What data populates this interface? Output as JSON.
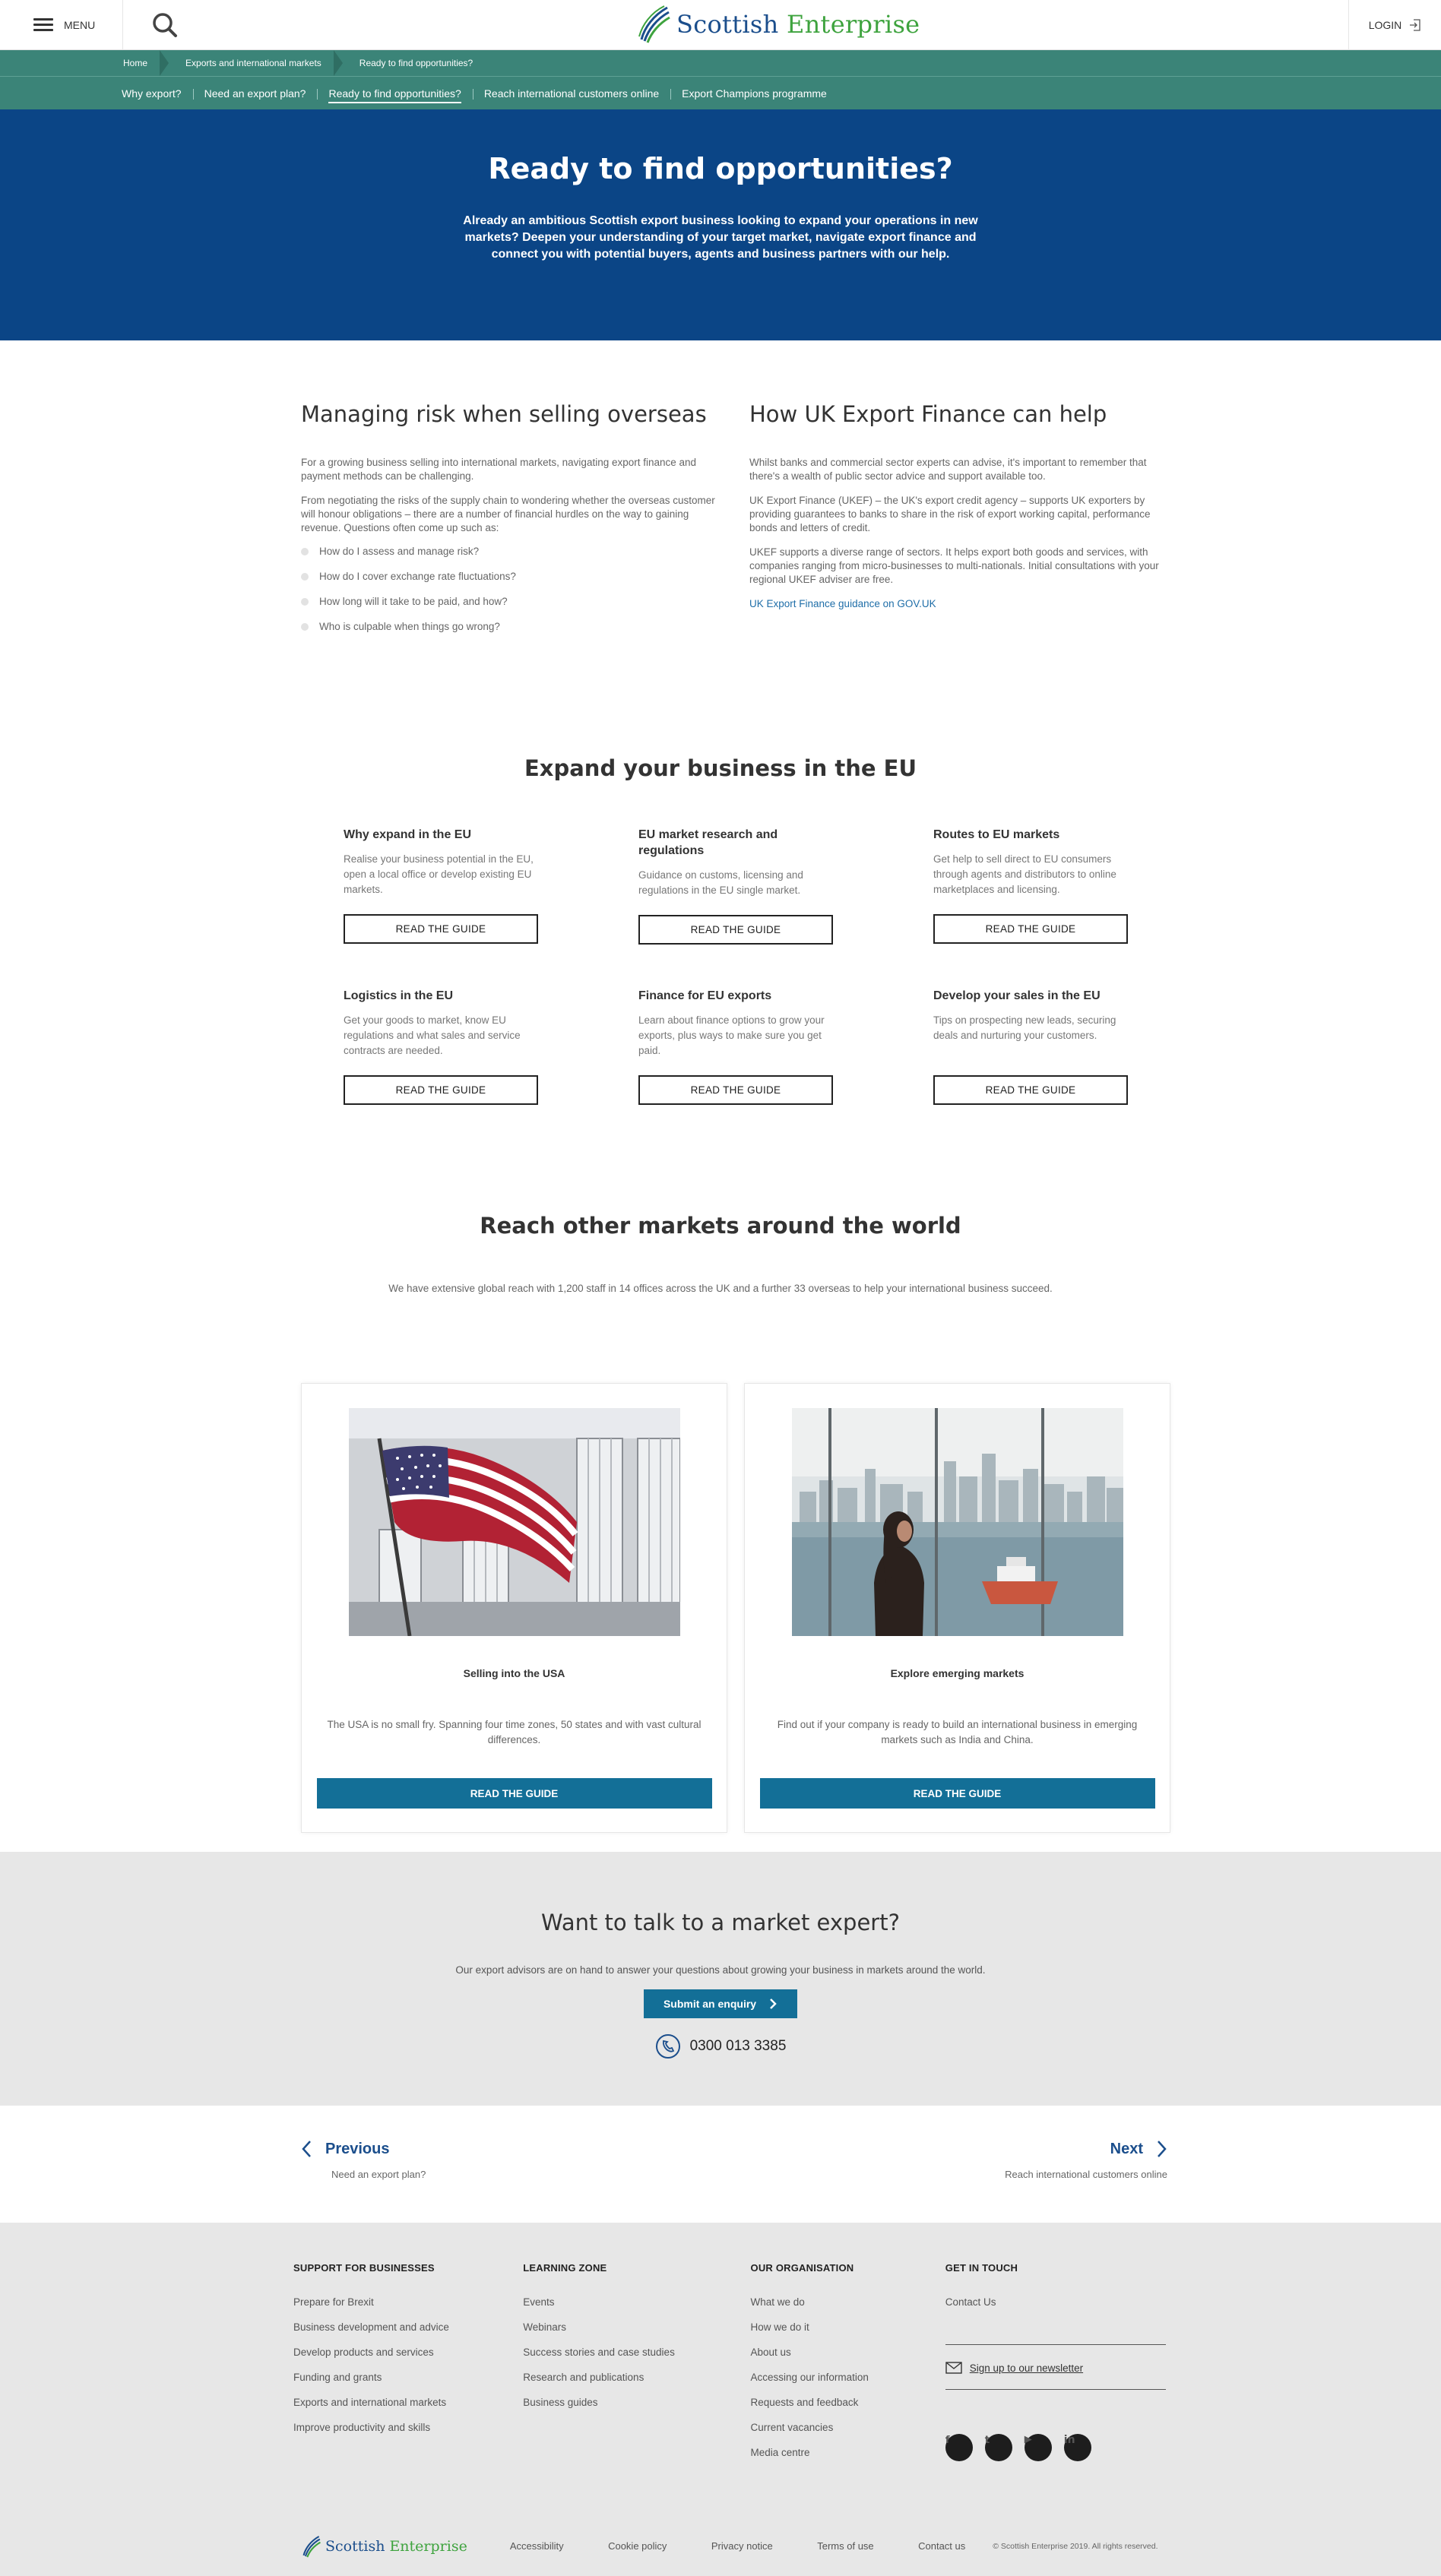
{
  "header": {
    "menu_label": "MENU",
    "logo_word1": "Scottish",
    "logo_word2": "Enterprise",
    "login_label": "LOGIN"
  },
  "breadcrumb": [
    "Home",
    "Exports and international markets",
    "Ready to find opportunities?"
  ],
  "subnav": [
    {
      "label": "Why export?",
      "active": false
    },
    {
      "label": "Need an export plan?",
      "active": false
    },
    {
      "label": "Ready to find opportunities?",
      "active": true
    },
    {
      "label": "Reach international customers online",
      "active": false
    },
    {
      "label": "Export Champions programme",
      "active": false
    }
  ],
  "hero": {
    "title": "Ready to find opportunities?",
    "text": "Already an ambitious Scottish export business looking to expand your operations in new markets? Deepen your understanding of your target market, navigate export finance and connect you with potential buyers, agents and business partners with our help."
  },
  "risk": {
    "title": "Managing risk when selling overseas",
    "p1": "For a growing business selling into international markets, navigating export finance and payment methods can be challenging.",
    "p2": "From negotiating the risks of the supply chain to wondering whether the overseas customer will honour obligations – there are a number of financial hurdles on the way to gaining revenue. Questions often come up such as:",
    "questions": [
      "How do I assess and manage risk?",
      "How do I cover exchange rate fluctuations?",
      "How long will it take to be paid, and how?",
      "Who is culpable when things go wrong?"
    ]
  },
  "ukef": {
    "title": "How UK Export Finance can help",
    "p1": "Whilst banks and commercial sector experts can advise, it's important to remember that there's a wealth of public sector advice and support available too.",
    "p2": "UK Export Finance (UKEF) – the UK's export credit agency – supports UK exporters by providing guarantees to banks to share in the risk of export working capital, performance bonds and letters of credit.",
    "p3": "UKEF supports a diverse range of sectors. It helps export both goods and services, with companies ranging from micro-businesses to multi-nationals. Initial consultations with your regional UKEF adviser are free.",
    "link": "UK Export Finance guidance on GOV.UK"
  },
  "eu": {
    "title": "Expand your business in the EU",
    "button_label": "READ THE GUIDE",
    "cards": [
      {
        "title": "Why expand in the EU",
        "text": "Realise your business potential in the EU, open a local office or develop existing EU markets."
      },
      {
        "title": "EU market research and regulations",
        "text": "Guidance on customs, licensing and regulations in the EU single market."
      },
      {
        "title": "Routes to EU markets",
        "text": "Get help to sell direct to EU consumers through agents and distributors to online marketplaces and licensing."
      },
      {
        "title": "Logistics in the EU",
        "text": "Get your goods to market, know EU regulations and what sales and service contracts are needed."
      },
      {
        "title": "Finance for EU exports",
        "text": "Learn about finance options to grow your exports, plus ways to make sure you get paid."
      },
      {
        "title": "Develop your sales in the EU",
        "text": "Tips on prospecting new leads, securing deals and nurturing your customers."
      }
    ]
  },
  "reach": {
    "title": "Reach other markets around the world",
    "text": "We have extensive global reach with 1,200 staff in 14 offices across the UK and a further 33 overseas to help your international business succeed.",
    "button_label": "READ THE GUIDE",
    "cards": [
      {
        "title": "Selling into the USA",
        "text": "The USA is no small fry. Spanning four time zones, 50 states and with vast cultural differences."
      },
      {
        "title": "Explore emerging markets",
        "text": "Find out if your company is ready to build an international business in emerging markets such as India and China."
      }
    ]
  },
  "expert": {
    "title": "Want to talk to a market expert?",
    "text": "Our export advisors are on hand to answer your questions about growing your business in markets around the world.",
    "button": "Submit an enquiry",
    "phone": "0300 013 3385"
  },
  "pager": {
    "prev_label": "Previous",
    "prev_sub": "Need an export plan?",
    "next_label": "Next",
    "next_sub": "Reach international customers online"
  },
  "footer": {
    "cols": [
      {
        "title": "SUPPORT FOR BUSINESSES",
        "links": [
          "Prepare for Brexit",
          "Business development and advice",
          "Develop products and services",
          "Funding and grants",
          "Exports and international markets",
          "Improve productivity and skills"
        ]
      },
      {
        "title": "LEARNING ZONE",
        "links": [
          "Events",
          "Webinars",
          "Success stories and case studies",
          "Research and publications",
          "Business guides"
        ]
      },
      {
        "title": "OUR ORGANISATION",
        "links": [
          "What we do",
          "How we do it",
          "About us",
          "Accessing our information",
          "Requests and feedback",
          "Current vacancies",
          "Media centre"
        ]
      },
      {
        "title": "GET IN TOUCH",
        "links": [
          "Contact Us"
        ]
      }
    ],
    "newsletter": "Sign up to our newsletter",
    "socials": [
      "f",
      "t",
      "▶",
      "in"
    ],
    "bottom_links": [
      "Accessibility",
      "Cookie policy",
      "Privacy notice",
      "Terms of use",
      "Contact us"
    ],
    "copyright": "© Scottish Enterprise 2019. All rights reserved."
  },
  "colors": {
    "teal": "#3b8478",
    "navy": "#0b4586",
    "button_blue": "#136f97",
    "logo_blue": "#1b4e8c",
    "logo_green": "#3ea33e"
  }
}
